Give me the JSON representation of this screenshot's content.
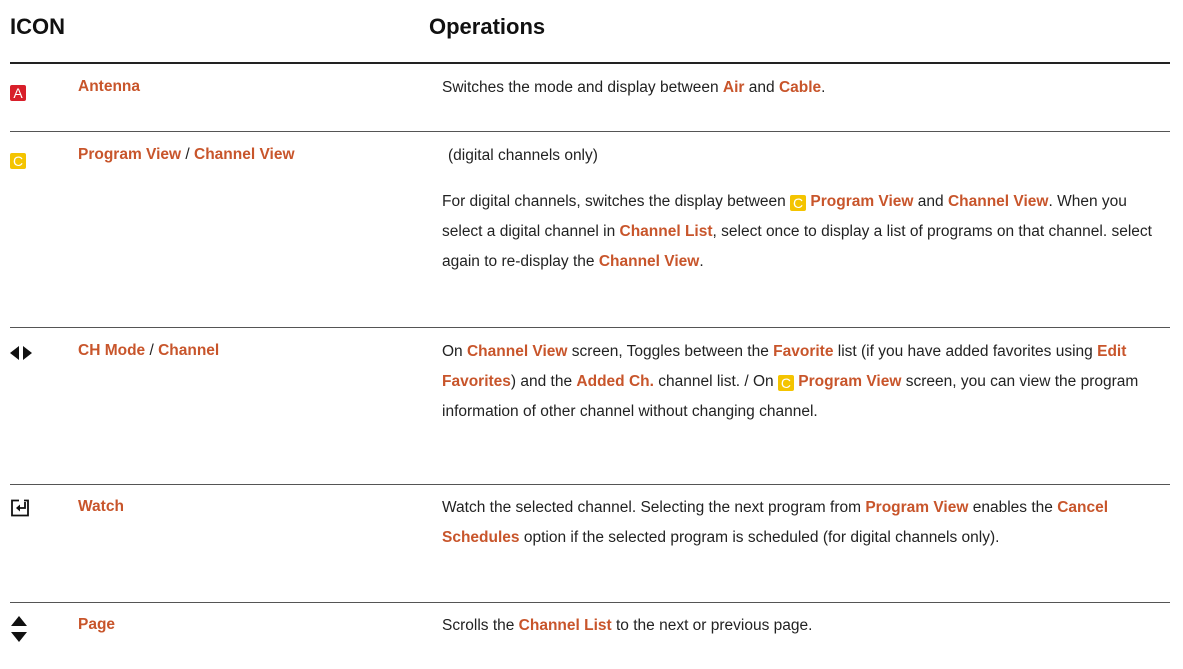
{
  "header": {
    "icon_col": "ICON",
    "ops_col": "Operations"
  },
  "rows": [
    {
      "icon": "red-A-badge",
      "icon_letter": "A",
      "name_a": "Antenna",
      "desc": {
        "t1": "Switches the mode and display between ",
        "b1": "Air",
        "t2": " and ",
        "b2": "Cable",
        "t3": "."
      }
    },
    {
      "icon": "yellow-C-badge",
      "icon_letter": "C",
      "name_a": "Program View",
      "sep": " / ",
      "name_b": "Channel View",
      "desc_first": "(digital channels only)",
      "desc": {
        "t1": "For digital channels, switches the display between ",
        "badge": "C",
        "b1": " Program View",
        "t2": " and ",
        "b2": "Channel View",
        "t3": ". When you select a digital channel in ",
        "b3": "Channel List",
        "t4": ", select once to display a list of programs on that channel. select again to re-display the ",
        "b4": "Channel View",
        "t5": "."
      }
    },
    {
      "icon": "left-right-arrows-icon",
      "name_a": "CH Mode",
      "sep": " / ",
      "name_b": "Channel",
      "desc": {
        "t1": "On ",
        "b1": "Channel View",
        "t2": " screen, Toggles between the ",
        "b2": "Favorite",
        "t3": " list (if you have added favorites using ",
        "b3": "Edit Favorites",
        "t4": ") and the ",
        "b4": "Added Ch.",
        "t5": " channel list. / On ",
        "badge": "C",
        "b5": " Program View",
        "t6": " screen, you can view the program information of other channel without changing channel."
      }
    },
    {
      "icon": "enter-return-icon",
      "name_a": "Watch",
      "desc": {
        "t1": "Watch the selected channel. Selecting the next program from ",
        "b1": "Program View",
        "t2": " enables the ",
        "b2": "Cancel Schedules",
        "t3": " option if the selected program is scheduled (for digital channels only)."
      }
    },
    {
      "icon": "up-down-arrows-icon",
      "name_a": "Page",
      "desc": {
        "t1": "Scrolls the ",
        "b1": "Channel List",
        "t2": " to the next or previous page."
      }
    }
  ]
}
